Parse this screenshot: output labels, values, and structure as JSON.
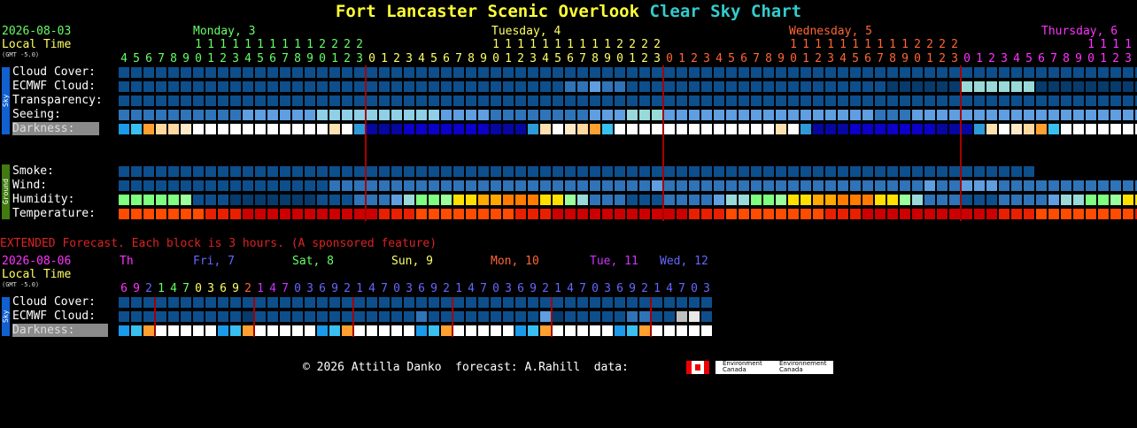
{
  "title": {
    "name": "Fort Lancaster Scenic Overlook",
    "suffix": "Clear Sky Chart"
  },
  "header": {
    "date": "2026-08-03",
    "local_time": "Local Time",
    "gmt": "(GMT -5.0)"
  },
  "days": [
    {
      "label": "Monday, 3",
      "color": "#66ff66"
    },
    {
      "label": "Tuesday, 4",
      "color": "#ffff66"
    },
    {
      "label": "Wednesday, 5",
      "color": "#ff6633"
    },
    {
      "label": "Thursday, 6",
      "color": "#ff33ff"
    }
  ],
  "sky_label": "Sky",
  "ground_label": "Ground",
  "rows": {
    "cloud": "Cloud Cover:",
    "ecmwf": "ECMWF Cloud:",
    "transparency": "Transparency:",
    "seeing": "Seeing:",
    "darkness": "Darkness:",
    "smoke": "Smoke:",
    "wind": "Wind:",
    "humidity": "Humidity:",
    "temperature": "Temperature:"
  },
  "extended": {
    "note": "EXTENDED Forecast. Each block is 3 hours. (A sponsored feature)",
    "date": "2026-08-06",
    "local_time": "Local Time",
    "gmt": "(GMT -5.0)",
    "days": [
      {
        "label": "Th",
        "color": "#ff33ff"
      },
      {
        "label": "Fri, 7",
        "color": "#6666ff"
      },
      {
        "label": "Sat, 8",
        "color": "#66ff66"
      },
      {
        "label": "Sun, 9",
        "color": "#ffff66"
      },
      {
        "label": "Mon, 10",
        "color": "#ff6633"
      },
      {
        "label": "Tue, 11",
        "color": "#cc33ff"
      },
      {
        "label": "Wed, 12",
        "color": "#6666ff"
      }
    ],
    "row_cloud": "Cloud Cover:",
    "row_ecmwf": "ECMWF Cloud:",
    "row_darkness": "Darkness:"
  },
  "footer": {
    "text": "© 2026 Attilla Danko  forecast: A.Rahill  data:",
    "logo1": "Environment Canada",
    "logo2": "Environnement Canada"
  },
  "chart_data": {
    "type": "heatmap",
    "hours": [
      4,
      5,
      6,
      7,
      8,
      9,
      10,
      11,
      12,
      13,
      14,
      15,
      16,
      17,
      18,
      19,
      20,
      21,
      22,
      23,
      0,
      1,
      2,
      3,
      4,
      5,
      6,
      7,
      8,
      9,
      10,
      11,
      12,
      13,
      14,
      15,
      16,
      17,
      18,
      19,
      20,
      21,
      22,
      23,
      0,
      1,
      2,
      3,
      4,
      5,
      6,
      7,
      8,
      9,
      10,
      11,
      12,
      13,
      14,
      15,
      16,
      17,
      18,
      19,
      20,
      21,
      22,
      23,
      0,
      1,
      2,
      3,
      4,
      5,
      6,
      7,
      8,
      9,
      10,
      11,
      12,
      13,
      14,
      15,
      16,
      17,
      18,
      19,
      20,
      21,
      22,
      23
    ],
    "cloud_cover": "MMMMMMMMMMMMMMMMMMMMMMMMMMMMMMMMMMMMMMMMMMMMMMMMMMMMMMMMMMMMMMMMMMMMMMMMMMMMMMMMMMMMMMMMMMMM",
    "ecmwf_cloud": "MMMMMMMMMMMMMMMMMMMMMMMMMMMMMMMMMMMMNNONNMMMMMMMMMMMMMMMMMMMMMLLLLLLPPPPPPLLLLLLLLLLLLLLL",
    "transparency": "MMMMMMMMMMMMMMMMMMMMMMMMMMMMMMMMMMMMMMMMMMMMMMMMMMMMMMMMMMMMMMMMMMMMMMMMMMMMMMMMMMMMMMMMMMMM",
    "seeing": "NNNNNNNNNNOOOOOOQQQQQQQQQQOOOONNNNNNNNOOOPPPOOOOOOOOOOOOOOOOONNNOOOOOOOOOOOOOOOOOOOOOONNN",
    "darkness": "abcddefffffffffffgfhiiijjjjjjjiiihgfedcbfffffffffffffgfhiiijjjjjjjiiihgfedcbffffffffffffgfh",
    "smoke": "MMMMMMMMMMMMMMMMMMMMMMMMMMMMMMMMMMMMMMMMMMMMMMMMMMMMMMMMMMMMMMMMMMMMMMMMMM",
    "wind": "MMMMMMMMMMMMMMMMMNNNNNNNNNNNNNNNNNNNNNNNNNNONNNNNNNNNNNNNNNNNNNNNONNOOONNNNNNNNNNNNNNNNNNNNN",
    "humidity": "rrrrrsMMMLLLLLLLMMMNNNOPrrsttuuvvvttsPNNNMMMNNNNOPPrrsttuuvvvttsPNNNMMMNNNNOPPrrsttuuvvvtts",
    "temperature": "wwwwwwwxxxyyyyyyyyyyyxxxwwwwwwwwxxxyyyyyyyyyyyxxxwwwwwwwwxxxyyyyyyyyyyyxxxwwwwwwwwxxxyyyyyy",
    "ext_hours": [
      6,
      9,
      2,
      1,
      4,
      7,
      0,
      3,
      6,
      9,
      2,
      1,
      4,
      7,
      0,
      3,
      6,
      9,
      2,
      1,
      4,
      7,
      0,
      3,
      6,
      9,
      2,
      1,
      4,
      7,
      0,
      3,
      6,
      9,
      2,
      1,
      4,
      7,
      0,
      3,
      6,
      9,
      2,
      1,
      4,
      7,
      0,
      3
    ],
    "ext_cloud": "MMMMMMMMMMMMMMMMMMMMMMMMMMMMMMMMMMMMMMMMMMMMMMMMMMMMMMMMMMMMMMMM",
    "ext_ecmwf": "MMMMMMMMMMLMMMMMMMMMMMMMNMMMMMMMMMOLMMMMMNNMMRSMNRSO",
    "ext_darkness": "abcfffffabcfffffabcfffffabcfffffabcfffffabcfffffabcfffff"
  }
}
